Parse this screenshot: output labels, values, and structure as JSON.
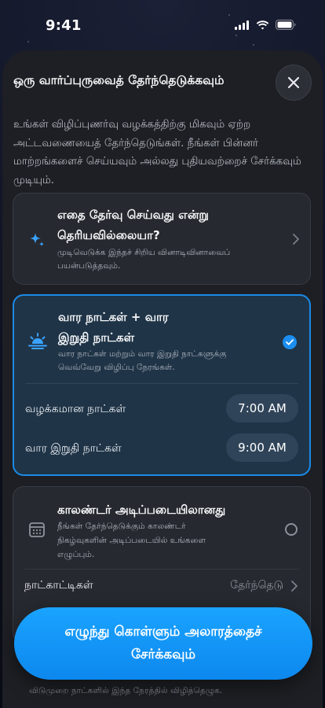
{
  "status_bar": {
    "time": "9:41"
  },
  "sheet": {
    "title": "ஒரு வார்ப்புருவைத் தேர்ந்தெடுக்கவும்",
    "intro": "உங்கள் விழிப்புணர்வு வழக்கத்திற்கு மிகவும் ஏற்ற அட்டவணையைத் தேர்ந்தெடுங்கள். நீங்கள் பின்னர் மாற்றங்களைச் செய்யவும் அல்லது புதியவற்றைச் சேர்க்கவும் முடியும்."
  },
  "cards": {
    "quiz": {
      "title_line1": "எதை தேர்வு செய்வது என்று",
      "title_line2": "தெரியவில்லையா?",
      "desc_line1": "முடிவெடுக்க இந்தச் சிறிய வினாடிவினாவைப்",
      "desc_line2": "பயன்படுத்தவும்.",
      "icon": "sparkle-icon"
    },
    "weekday_weekend": {
      "title_line1": "வார நாட்கள் + வார",
      "title_line2": "இறுதி நாட்கள்",
      "desc_line1": "வார நாட்கள் மற்றும் வார இறுதி நாட்களுக்கு",
      "desc_line2": "வெவ்வேறு விழிப்பு நேரங்கள்.",
      "icon": "sunrise-icon",
      "selected": true,
      "rows": [
        {
          "label": "வழக்கமான நாட்கள்",
          "time": "7:00 AM"
        },
        {
          "label": "வார இறுதி நாட்கள்",
          "time": "9:00 AM"
        }
      ]
    },
    "calendar": {
      "title": "காலண்டர் அடிப்படையிலானது",
      "desc_line1": "நீங்கள் தேர்ந்தெடுக்கும் காலண்டர்",
      "desc_line2": "நிகழ்வுகளின் அடிப்படையில் உங்களை",
      "desc_line3": "எழுப்பும்.",
      "icon": "calendar-icon",
      "selected": false,
      "row_label": "நாட்காட்டிகள்",
      "row_value": "தேர்ந்தெடு"
    }
  },
  "cta": {
    "line1": "எழுந்து கொள்ளும் அலாரத்தைச்",
    "line2": "சேர்க்கவும்"
  },
  "footer_hint": "விடுமுறை நாட்களில் இந்த நேரத்தில் விழித்தெழுக.",
  "colors": {
    "accent": "#1b8ae6",
    "sheet_bg": "#1d1f24",
    "card_bg": "#26292f",
    "selected_bg": "#1f3447"
  }
}
